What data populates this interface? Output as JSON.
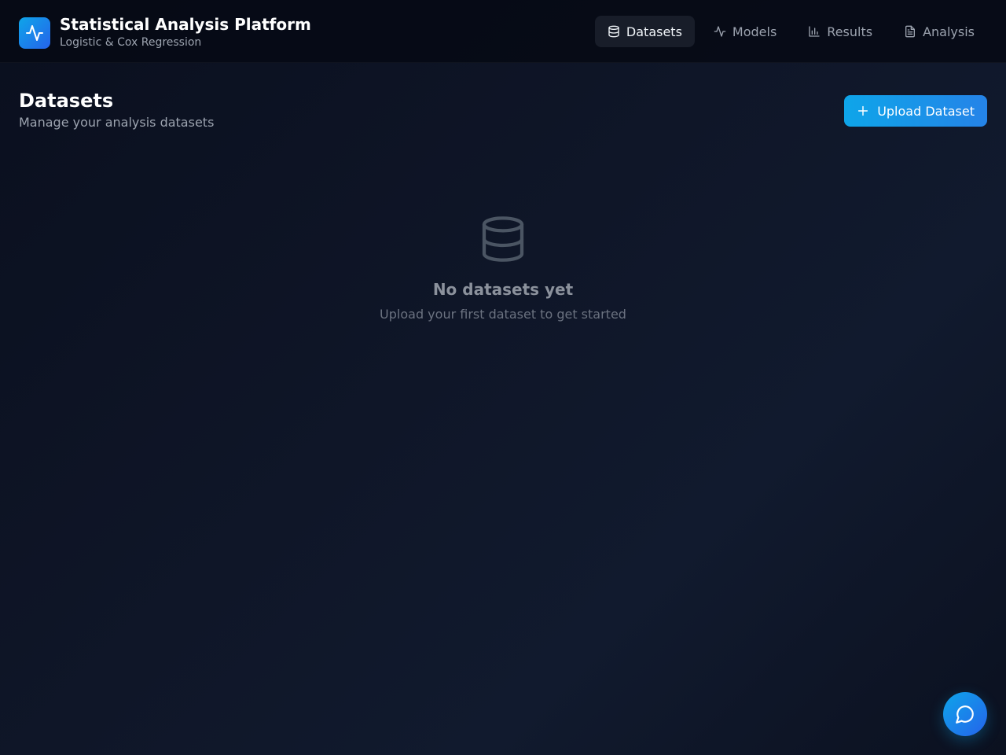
{
  "app": {
    "title": "Statistical Analysis Platform",
    "subtitle": "Logistic & Cox Regression",
    "logo_icon": "activity-pulse-icon"
  },
  "nav": {
    "items": [
      {
        "label": "Datasets",
        "icon": "database-icon",
        "active": true
      },
      {
        "label": "Models",
        "icon": "activity-icon",
        "active": false
      },
      {
        "label": "Results",
        "icon": "bar-chart-icon",
        "active": false
      },
      {
        "label": "Analysis",
        "icon": "file-text-icon",
        "active": false
      }
    ]
  },
  "page": {
    "title": "Datasets",
    "subtitle": "Manage your analysis datasets",
    "upload_label": "Upload Dataset"
  },
  "empty_state": {
    "icon": "database-icon",
    "title": "No datasets yet",
    "subtitle": "Upload your first dataset to get started"
  },
  "chat": {
    "icon": "chat-bubble-icon"
  },
  "colors": {
    "accent": "#0ea5e9",
    "accent_secondary": "#2563eb",
    "background": "#0f1628"
  }
}
